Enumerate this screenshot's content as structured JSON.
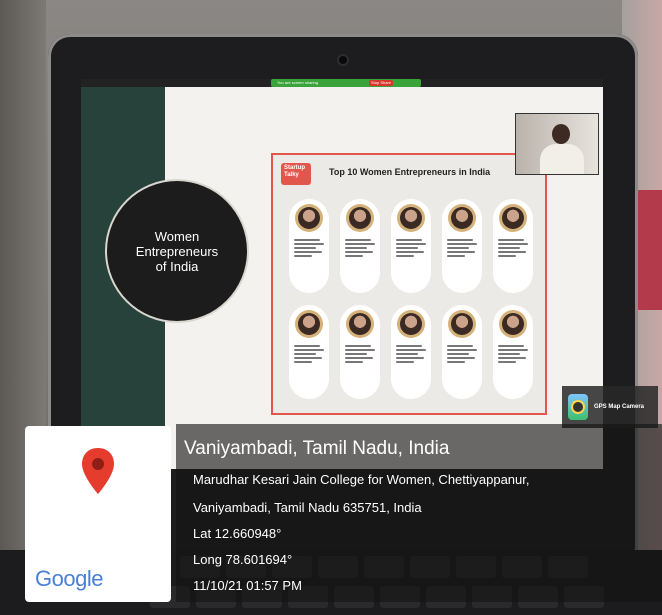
{
  "zoom_bar": {
    "status_text": "You are screen sharing",
    "stop_label": "Stop Share"
  },
  "slide": {
    "circle_text": "Women\nEntrepreneurs\nof India"
  },
  "poster": {
    "logo_text": "Startup Talky",
    "title": "Top 10 Women Entrepreneurs in India",
    "card_count": 10
  },
  "gps_camera": {
    "badge_label": "GPS Map Camera",
    "place_title": "Vaniyambadi, Tamil Nadu, India",
    "address_line1": "Marudhar Kesari Jain College for Women, Chettiyappanur,",
    "address_line2": "Vaniyambadi, Tamil Nadu 635751, India",
    "latitude": "Lat 12.660948°",
    "longitude": "Long 78.601694°",
    "timestamp": "11/10/21 01:57 PM",
    "map_brand": "Google"
  },
  "colors": {
    "pin": "#e53c2e",
    "poster_accent": "#e1574c",
    "slide_green": "#27423a"
  }
}
